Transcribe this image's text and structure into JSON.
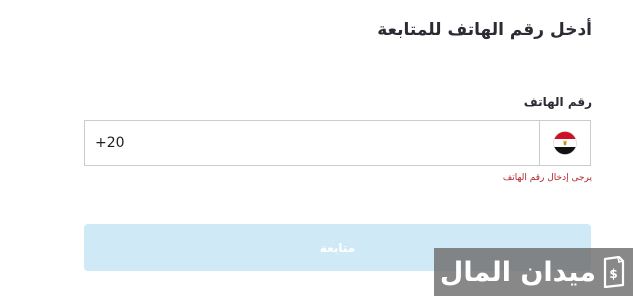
{
  "form": {
    "title": "أدخل رقم الهاتف للمتابعة",
    "phone_label": "رقم الهاتف",
    "phone_value": "+20",
    "country": {
      "name": "Egypt",
      "flag_icon": "egypt-flag-icon"
    },
    "error_message": "يرجى إدخال رقم الهاتف",
    "continue_label": "متابعة"
  },
  "watermark": {
    "text": "ميدان المال"
  },
  "colors": {
    "text": "#2b2b33",
    "error": "#b3262b",
    "button_disabled_bg": "#cfe9f6",
    "input_border": "#c9cdd2"
  }
}
